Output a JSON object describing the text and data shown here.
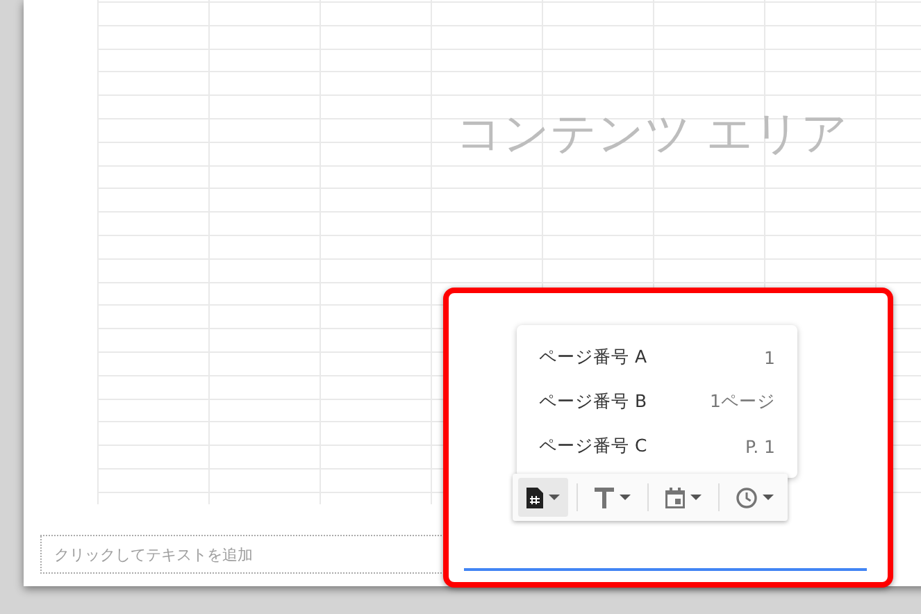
{
  "content_area": {
    "label": "コンテンツ エリア"
  },
  "page_number_menu": [
    {
      "label": "ページ番号 A",
      "example": "1"
    },
    {
      "label": "ページ番号 B",
      "example": "1ページ"
    },
    {
      "label": "ページ番号 C",
      "example": "P. 1"
    }
  ],
  "toolbar": [
    {
      "kind": "page-number",
      "selected": true
    },
    {
      "kind": "text",
      "selected": false
    },
    {
      "kind": "date",
      "selected": false
    },
    {
      "kind": "time",
      "selected": false
    }
  ],
  "footer": {
    "placeholder": "クリックしてテキストを追加"
  }
}
